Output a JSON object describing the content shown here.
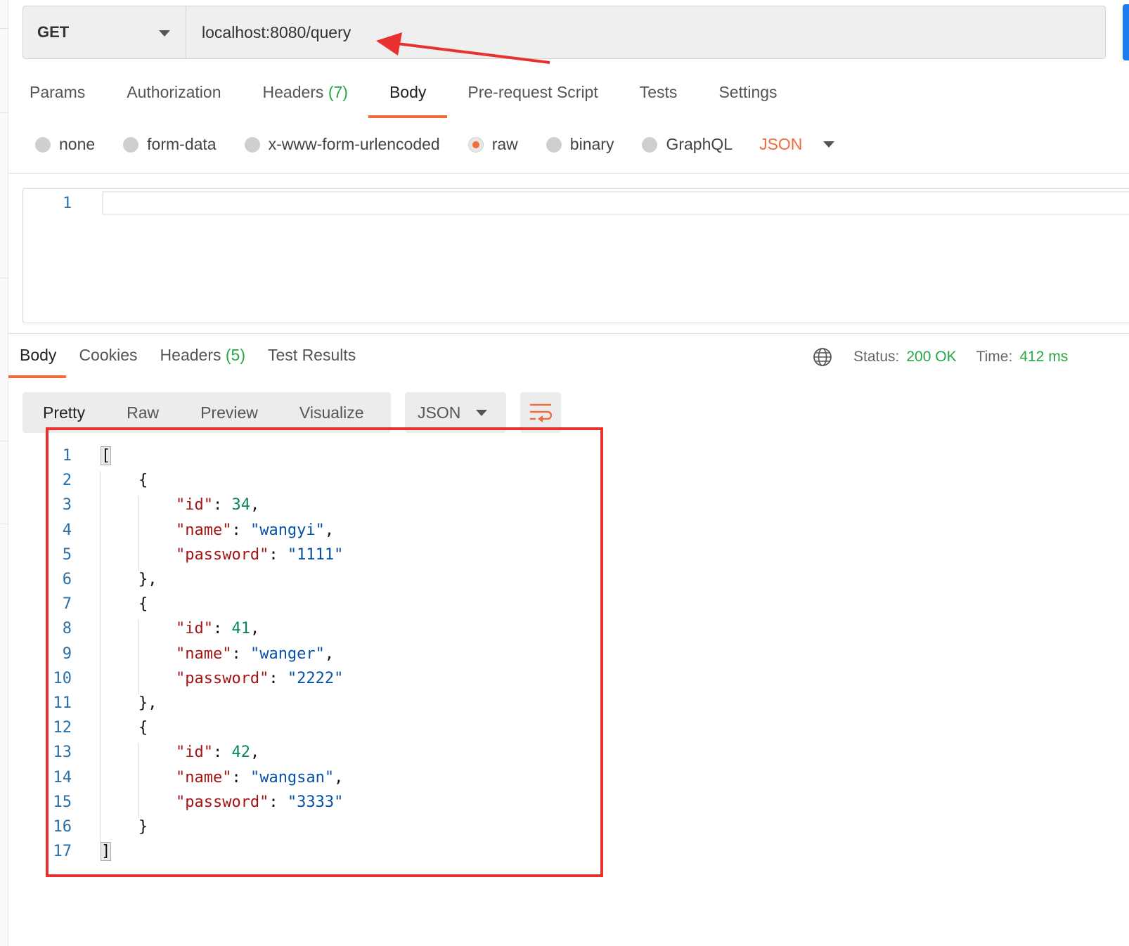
{
  "request": {
    "method": "GET",
    "url": "localhost:8080/query"
  },
  "request_tabs": [
    {
      "label": "Params",
      "count": ""
    },
    {
      "label": "Authorization",
      "count": ""
    },
    {
      "label": "Headers",
      "count": "(7)"
    },
    {
      "label": "Body",
      "count": "",
      "active": true
    },
    {
      "label": "Pre-request Script",
      "count": ""
    },
    {
      "label": "Tests",
      "count": ""
    },
    {
      "label": "Settings",
      "count": ""
    }
  ],
  "body_types": [
    {
      "label": "none",
      "selected": false
    },
    {
      "label": "form-data",
      "selected": false
    },
    {
      "label": "x-www-form-urlencoded",
      "selected": false
    },
    {
      "label": "raw",
      "selected": true
    },
    {
      "label": "binary",
      "selected": false
    },
    {
      "label": "GraphQL",
      "selected": false
    }
  ],
  "body_language": "JSON",
  "request_editor": {
    "line_number": "1"
  },
  "response_tabs": [
    {
      "label": "Body",
      "count": "",
      "active": true
    },
    {
      "label": "Cookies",
      "count": ""
    },
    {
      "label": "Headers",
      "count": "(5)"
    },
    {
      "label": "Test Results",
      "count": ""
    }
  ],
  "response_status": {
    "status_label": "Status:",
    "status_value": "200 OK",
    "time_label": "Time:",
    "time_value": "412 ms"
  },
  "view_modes": [
    "Pretty",
    "Raw",
    "Preview",
    "Visualize"
  ],
  "response_format": "JSON",
  "response_body": [
    {
      "id": 34,
      "name": "wangyi",
      "password": "1111"
    },
    {
      "id": 41,
      "name": "wanger",
      "password": "2222"
    },
    {
      "id": 42,
      "name": "wangsan",
      "password": "3333"
    }
  ],
  "icons": [
    "chevron-down-icon",
    "globe-icon",
    "wrap-lines-icon",
    "annotation-arrow"
  ],
  "colors": {
    "accent": "#f26b3a",
    "success": "#28a745",
    "annotation": "#e8302f",
    "send": "#1b7cf2"
  }
}
